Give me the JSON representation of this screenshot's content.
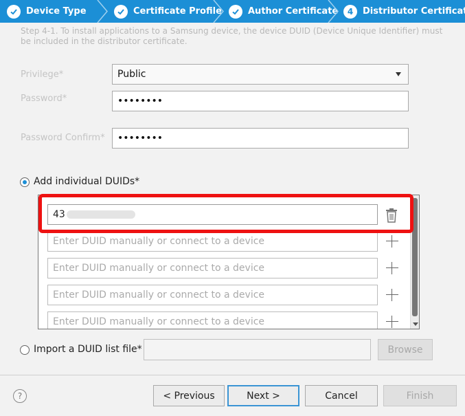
{
  "steps": [
    {
      "label": "Device Type",
      "state": "done",
      "icon": "check-icon"
    },
    {
      "label": "Certificate Profile",
      "state": "done",
      "icon": "check-icon"
    },
    {
      "label": "Author Certificate",
      "state": "done",
      "icon": "check-icon"
    },
    {
      "label": "Distributor Certificate",
      "state": "current",
      "number": "4"
    }
  ],
  "description": "Step 4-1. To install applications to a Samsung device, the device DUID (Device Unique Identifier) must be included in the distributor certificate.",
  "form": {
    "privilege_label": "Privilege*",
    "privilege_value": "Public",
    "password_label": "Password*",
    "password_value": "••••••••",
    "password_confirm_label": "Password Confirm*",
    "password_confirm_value": "••••••••"
  },
  "duid": {
    "individual_label": "Add individual DUIDs*",
    "individual_selected": true,
    "entries": [
      {
        "value": "43",
        "filled": true
      },
      {
        "placeholder": "Enter DUID manually or connect to a device"
      },
      {
        "placeholder": "Enter DUID manually or connect to a device"
      },
      {
        "placeholder": "Enter DUID manually or connect to a device"
      },
      {
        "placeholder": "Enter DUID manually or connect to a device"
      }
    ],
    "import_label": "Import a DUID list file*",
    "import_selected": false,
    "browse_label": "Browse"
  },
  "footer": {
    "help": "?",
    "previous": "< Previous",
    "next": "Next >",
    "cancel": "Cancel",
    "finish": "Finish"
  },
  "colors": {
    "accent": "#1c8fd6",
    "highlight": "#ee1111"
  }
}
